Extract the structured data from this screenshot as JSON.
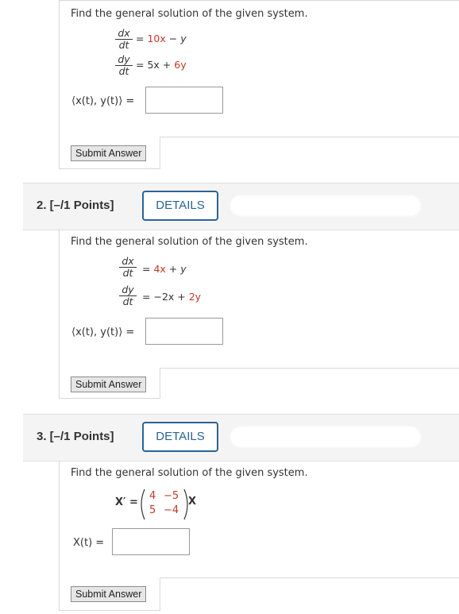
{
  "q1": {
    "prompt": "Find the general solution of the given system.",
    "eq1_rhs_a": "10x",
    "eq1_rhs_b": "− y",
    "eq2_rhs_a": "5x + ",
    "eq2_rhs_b": "6y",
    "answer_label": "⟨x(t), y(t)⟩ =",
    "submit_label": "Submit Answer"
  },
  "q2": {
    "header": "2.  [–/1 Points]",
    "details_label": "DETAILS",
    "prompt": "Find the general solution of the given system.",
    "eq1_rhs_a": "4x",
    "eq1_rhs_b": " + y",
    "eq2_rhs_a": "−2x + ",
    "eq2_rhs_b": "2y",
    "answer_label": "⟨x(t), y(t)⟩ =",
    "submit_label": "Submit Answer"
  },
  "q3": {
    "header": "3.  [–/1 Points]",
    "details_label": "DETAILS",
    "prompt": "Find the general solution of the given system.",
    "lhs": "X′ =",
    "matrix": [
      [
        "4",
        "−5"
      ],
      [
        "5",
        "−4"
      ]
    ],
    "rhs_var": "X",
    "answer_label": "X(t) =",
    "submit_label": "Submit Answer"
  },
  "fraction": {
    "dx": "dx",
    "dy": "dy",
    "dt": "dt",
    "eq_sign": "="
  }
}
